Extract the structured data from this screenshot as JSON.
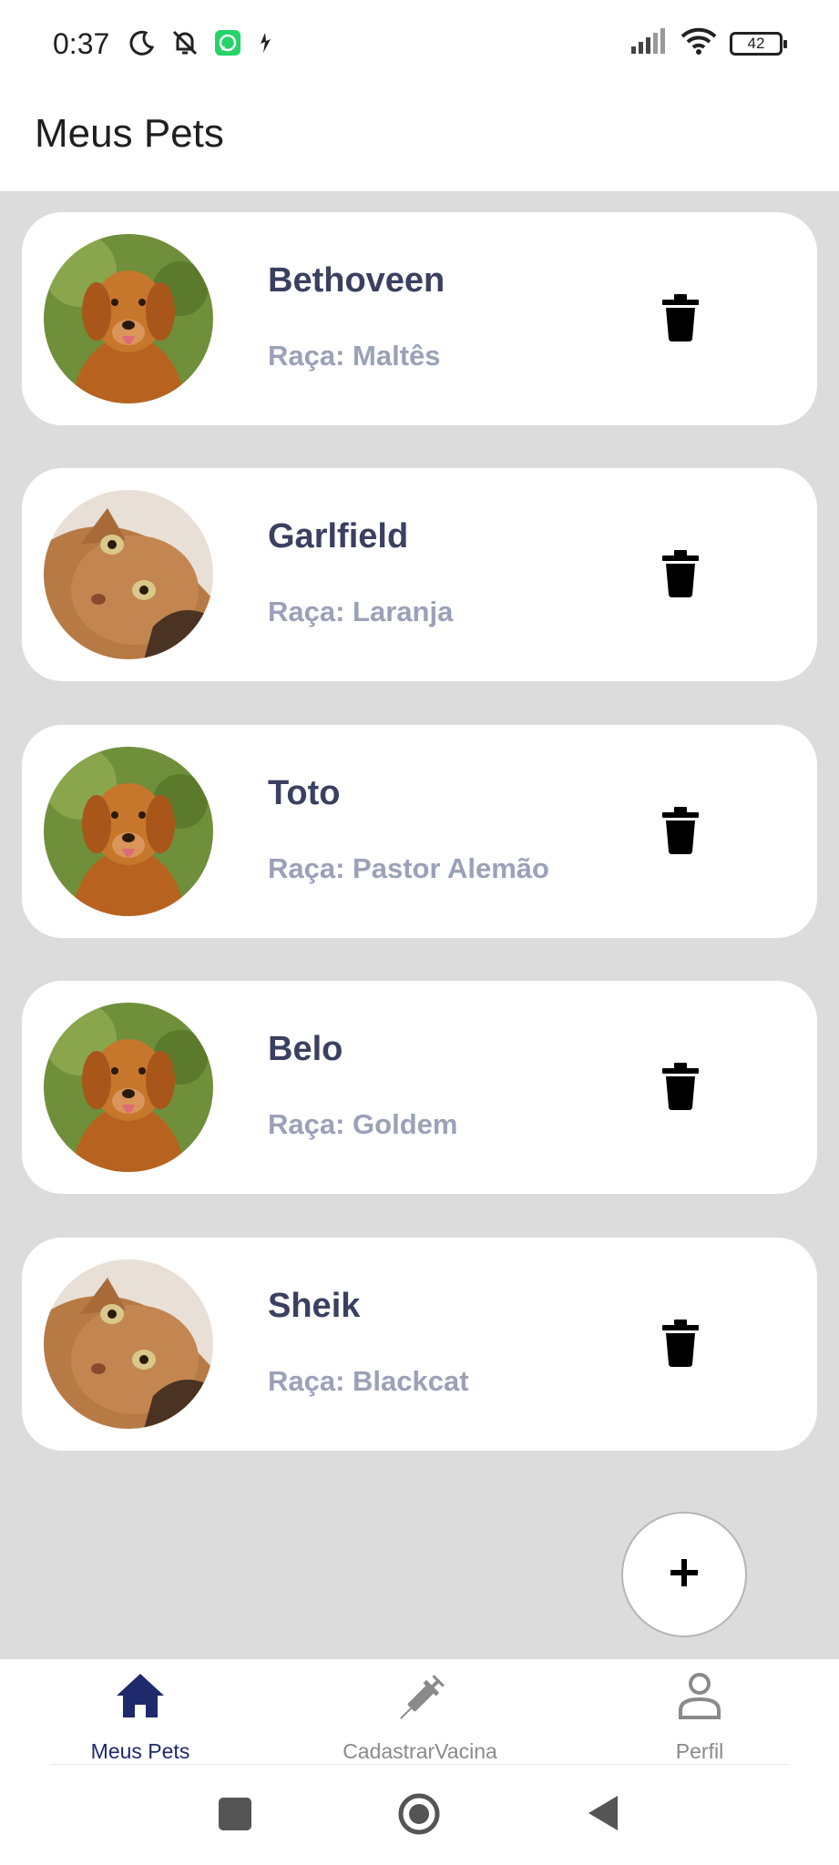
{
  "status_bar": {
    "time": "0:37",
    "battery": "42"
  },
  "header": {
    "title": "Meus Pets"
  },
  "pets": [
    {
      "name": "Bethoveen",
      "breed": "Raça: Maltês",
      "photo": "dog"
    },
    {
      "name": "Garlfield",
      "breed": "Raça: Laranja",
      "photo": "cat"
    },
    {
      "name": "Toto",
      "breed": "Raça: Pastor Alemão",
      "photo": "dog"
    },
    {
      "name": "Belo",
      "breed": "Raça: Goldem",
      "photo": "dog"
    },
    {
      "name": "Sheik",
      "breed": "Raça: Blackcat",
      "photo": "cat"
    }
  ],
  "fab": {
    "icon": "plus-icon"
  },
  "bottom_nav": {
    "items": [
      {
        "label": "Meus Pets",
        "icon": "home-icon",
        "active": true
      },
      {
        "label": "CadastrarVacina",
        "icon": "syringe-icon",
        "active": false
      },
      {
        "label": "Perfil",
        "icon": "person-icon",
        "active": false
      }
    ]
  },
  "colors": {
    "background": "#dcdcdc",
    "card": "#ffffff",
    "name": "#3a4060",
    "breed": "#9aa1b8",
    "nav_active": "#1e2a6b",
    "nav_inactive": "#8a8a8a"
  }
}
